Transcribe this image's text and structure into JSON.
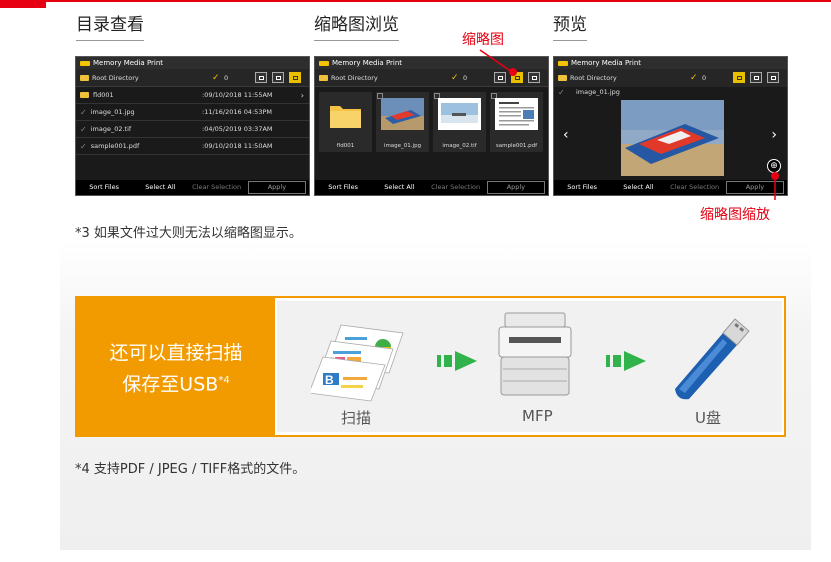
{
  "sections": {
    "list": {
      "title": "目录查看"
    },
    "thumb": {
      "title": "缩略图浏览",
      "annotation": "缩略图"
    },
    "preview": {
      "title": "预览",
      "annotation": "缩略图缩放"
    }
  },
  "screen_common": {
    "app_title": "Memory Media Print",
    "root_dir": "Root Directory",
    "count": "0",
    "footer": [
      "Sort Files",
      "Select All",
      "Clear Selection",
      "Apply"
    ]
  },
  "list_screen": {
    "rows": [
      {
        "name": "fld001",
        "date": ":09/10/2018 11:55AM",
        "type": "folder"
      },
      {
        "name": "image_01.jpg",
        "date": ":11/16/2016 04:53PM",
        "type": "file"
      },
      {
        "name": "image_02.tif",
        "date": ":04/05/2019 03:37AM",
        "type": "file"
      },
      {
        "name": "sample001.pdf",
        "date": ":09/10/2018 11:50AM",
        "type": "file"
      }
    ]
  },
  "thumb_screen": {
    "items": [
      "fld001",
      "image_01.jpg",
      "image_02.tif",
      "sample001.pdf"
    ]
  },
  "preview_screen": {
    "file": "image_01.jpg"
  },
  "notes": {
    "note3": "*3 如果文件过大则无法以缩略图显示。",
    "note4": "*4 支持PDF / JPEG / TIFF格式的文件。"
  },
  "scan": {
    "line1": "还可以直接扫描",
    "line2": "保存至USB",
    "sup": "*4",
    "labels": [
      "扫描",
      "MFP",
      "U盘"
    ]
  },
  "colors": {
    "accent": "#f29b00",
    "brand_red": "#e60012",
    "arrow_green": "#2fb34a",
    "usb_blue": "#1d5fb0"
  }
}
